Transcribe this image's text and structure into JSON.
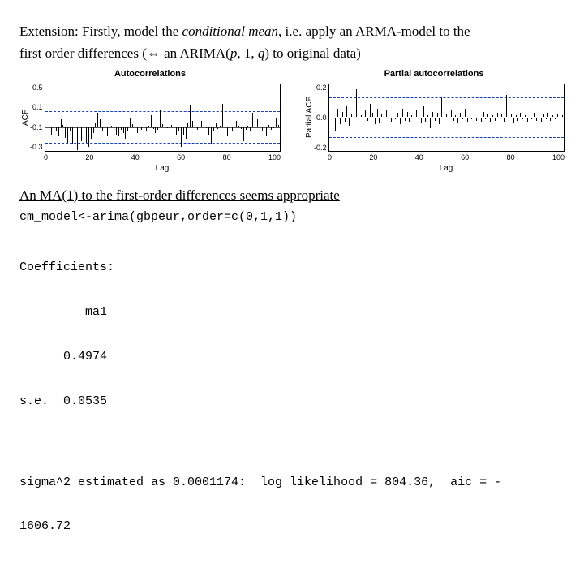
{
  "intro": {
    "line1_a": "Extension: Firstly, model the ",
    "line1_italic": "conditional mean",
    "line1_b": ", i.e. apply an ARMA-model to the",
    "line2_a": "first order differences (⇔ an ARIMA(",
    "line2_p": "p",
    "line2_mid": ", 1, ",
    "line2_q": "q",
    "line2_end": ") to original data)"
  },
  "chart_data": [
    {
      "type": "bar",
      "title": "Autocorrelations",
      "xlabel": "Lag",
      "ylabel": "ACF",
      "xticks": [
        "0",
        "20",
        "40",
        "60",
        "80",
        "100"
      ],
      "yticks": [
        "0.5",
        "0.1",
        "-0.1",
        "-0.3"
      ],
      "ylim": [
        -0.3,
        0.55
      ],
      "x": [
        1,
        2,
        3,
        4,
        5,
        6,
        7,
        8,
        9,
        10,
        11,
        12,
        13,
        14,
        15,
        16,
        17,
        18,
        19,
        20,
        21,
        22,
        23,
        24,
        25,
        26,
        27,
        28,
        29,
        30,
        31,
        32,
        33,
        34,
        35,
        36,
        37,
        38,
        39,
        40,
        41,
        42,
        43,
        44,
        45,
        46,
        47,
        48,
        49,
        50,
        51,
        52,
        53,
        54,
        55,
        56,
        57,
        58,
        59,
        60,
        61,
        62,
        63,
        64,
        65,
        66,
        67,
        68,
        69,
        70,
        71,
        72,
        73,
        74,
        75,
        76,
        77,
        78,
        79,
        80,
        81,
        82,
        83,
        84,
        85,
        86,
        87,
        88,
        89,
        90,
        91,
        92,
        93,
        94,
        95,
        96,
        97,
        98,
        99,
        100
      ],
      "values": [
        0.5,
        -0.1,
        -0.08,
        -0.05,
        -0.12,
        0.1,
        0.03,
        -0.14,
        -0.2,
        -0.06,
        -0.22,
        -0.08,
        -0.3,
        -0.1,
        -0.18,
        -0.12,
        -0.2,
        -0.25,
        -0.15,
        -0.08,
        0.05,
        0.18,
        0.1,
        -0.05,
        -0.02,
        -0.12,
        0.08,
        0.02,
        -0.06,
        -0.1,
        -0.12,
        -0.04,
        -0.08,
        -0.15,
        -0.06,
        0.12,
        0.04,
        -0.06,
        -0.08,
        -0.14,
        -0.04,
        0.06,
        -0.05,
        0.02,
        0.15,
        -0.03,
        -0.08,
        -0.04,
        0.22,
        0.04,
        -0.06,
        -0.02,
        0.1,
        0.03,
        -0.04,
        -0.1,
        -0.06,
        -0.25,
        -0.1,
        -0.15,
        0.05,
        0.28,
        0.08,
        -0.06,
        -0.04,
        -0.12,
        0.08,
        0.04,
        -0.02,
        -0.1,
        -0.22,
        -0.06,
        0.05,
        -0.03,
        0.02,
        0.3,
        0.03,
        -0.12,
        0.04,
        -0.06,
        -0.04,
        0.08,
        0.02,
        -0.03,
        -0.18,
        -0.04,
        0.02,
        -0.05,
        0.18,
        -0.02,
        0.1,
        0.04,
        -0.05,
        -0.02,
        -0.12,
        0.03,
        -0.04,
        -0.02,
        0.12,
        0.03
      ],
      "ci": 0.2
    },
    {
      "type": "bar",
      "title": "Partial autocorrelations",
      "xlabel": "Lag",
      "ylabel": "Partial ACF",
      "xticks": [
        "0",
        "20",
        "40",
        "60",
        "80",
        "100"
      ],
      "yticks": [
        "0.2",
        "0.0",
        "-0.2"
      ],
      "ylim": [
        -0.3,
        0.3
      ],
      "x": [
        1,
        2,
        3,
        4,
        5,
        6,
        7,
        8,
        9,
        10,
        11,
        12,
        13,
        14,
        15,
        16,
        17,
        18,
        19,
        20,
        21,
        22,
        23,
        24,
        25,
        26,
        27,
        28,
        29,
        30,
        31,
        32,
        33,
        34,
        35,
        36,
        37,
        38,
        39,
        40,
        41,
        42,
        43,
        44,
        45,
        46,
        47,
        48,
        49,
        50,
        51,
        52,
        53,
        54,
        55,
        56,
        57,
        58,
        59,
        60,
        61,
        62,
        63,
        64,
        65,
        66,
        67,
        68,
        69,
        70,
        71,
        72,
        73,
        74,
        75,
        76,
        77,
        78,
        79,
        80,
        81,
        82,
        83,
        84,
        85,
        86,
        87,
        88,
        89,
        90,
        91,
        92,
        93,
        94,
        95,
        96,
        97,
        98,
        99,
        100
      ],
      "values": [
        0.3,
        -0.12,
        0.08,
        -0.06,
        0.05,
        -0.04,
        0.1,
        -0.08,
        0.03,
        -0.1,
        0.25,
        -0.15,
        0.02,
        -0.04,
        0.06,
        -0.03,
        0.12,
        0.04,
        -0.06,
        0.08,
        -0.05,
        0.03,
        -0.1,
        0.06,
        0.02,
        -0.04,
        0.15,
        -0.02,
        0.04,
        -0.06,
        0.08,
        -0.03,
        0.05,
        -0.04,
        0.02,
        -0.08,
        0.06,
        0.03,
        -0.05,
        0.1,
        -0.04,
        0.02,
        -0.1,
        0.05,
        -0.03,
        0.04,
        -0.06,
        0.18,
        -0.02,
        0.03,
        -0.04,
        0.06,
        -0.03,
        0.02,
        -0.05,
        0.04,
        -0.02,
        0.08,
        -0.04,
        0.03,
        -0.02,
        0.18,
        -0.03,
        0.02,
        -0.04,
        0.05,
        -0.02,
        0.03,
        -0.04,
        0.02,
        -0.03,
        0.04,
        -0.02,
        0.03,
        -0.04,
        0.2,
        -0.02,
        0.03,
        -0.05,
        0.02,
        -0.03,
        0.04,
        -0.02,
        0.02,
        -0.04,
        0.03,
        -0.02,
        0.04,
        -0.03,
        0.02,
        -0.04,
        0.03,
        -0.02,
        0.04,
        -0.03,
        0.02,
        -0.02,
        0.03,
        -0.02,
        0.02
      ],
      "ci": 0.18
    }
  ],
  "conclusion": "An MA(1) to the first-order differences seems appropriate",
  "code": "cm_model<-arima(gbpeur,order=c(0,1,1))",
  "coef": {
    "hdr": "Coefficients:",
    "name_line": "         ma1",
    "est_line": "      0.4974",
    "se_line": "s.e.  0.0535"
  },
  "sigma": {
    "part1": "sigma^2 estimated as 0.0001174:",
    "part2": "log likelihood = 804.36,",
    "part3": "aic = -",
    "cont": "1606.72"
  }
}
